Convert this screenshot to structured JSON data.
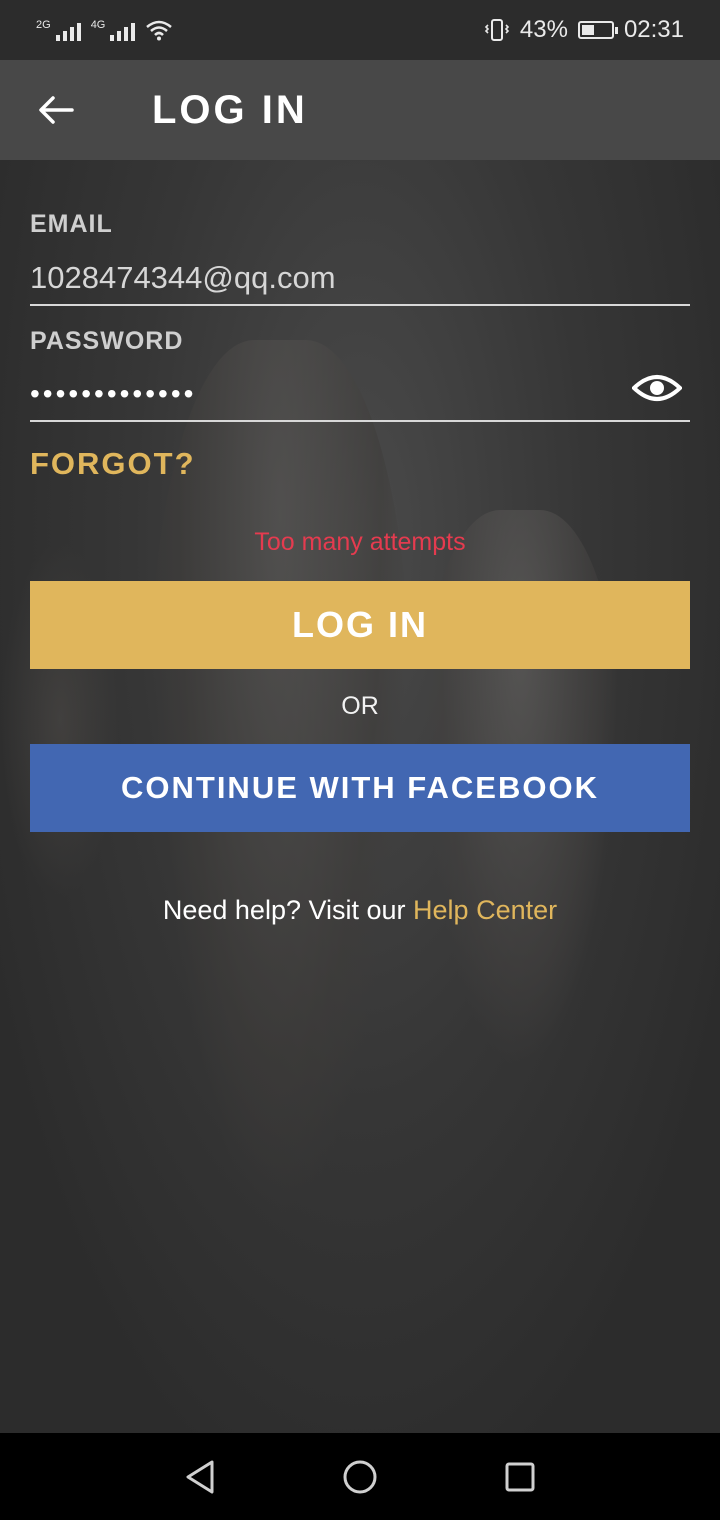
{
  "status_bar": {
    "signal_1_label": "2G",
    "signal_2_label": "4G",
    "battery_percent": "43%",
    "battery_level": 0.43,
    "time": "02:31"
  },
  "app_bar": {
    "title": "LOG IN"
  },
  "form": {
    "email_label": "EMAIL",
    "email_value": "1028474344@qq.com",
    "password_label": "PASSWORD",
    "password_value": "•••••••••••••",
    "forgot_label": "FORGOT?",
    "error_text": "Too many attempts",
    "login_button_label": "LOG IN",
    "or_label": "OR",
    "facebook_button_label": "CONTINUE WITH FACEBOOK",
    "help_text": "Need help? Visit our",
    "help_link": "Help Center"
  },
  "colors": {
    "accent_gold": "#e0b65c",
    "facebook_blue": "#4267b2",
    "error_red": "#e53b4f"
  },
  "icons": {
    "back": "arrow-left-icon",
    "password_visibility": "eye-icon",
    "nav_back": "triangle-back-icon",
    "nav_home": "circle-home-icon",
    "nav_recents": "square-recents-icon"
  }
}
